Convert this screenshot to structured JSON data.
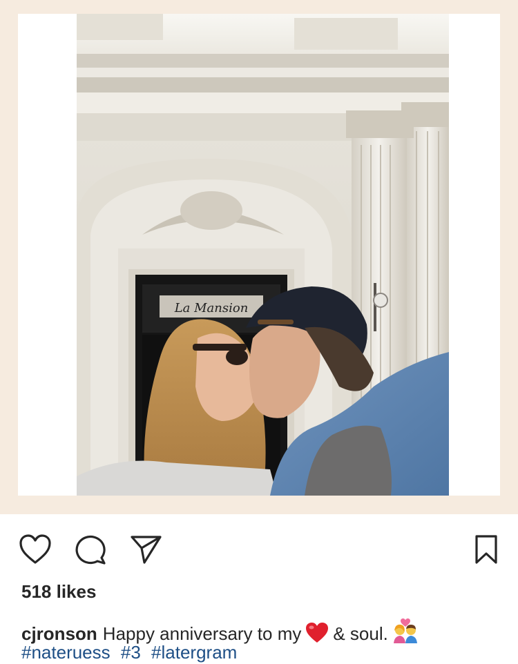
{
  "post": {
    "likes_text": "518 likes",
    "username": "cjronson",
    "caption_text_1": "Happy anniversary to my",
    "caption_emoji_1": "red-heart",
    "caption_text_2": "& soul.",
    "caption_emoji_2": "couple-with-heart",
    "hashtags": [
      "#nateruess",
      "#3",
      "#latergram"
    ],
    "sign_text": "La Mansion"
  },
  "actions": {
    "like_icon": "heart-icon",
    "comment_icon": "comment-icon",
    "share_icon": "send-icon",
    "save_icon": "bookmark-icon"
  },
  "colors": {
    "frame_background": "#f6ebdf",
    "text": "#262626",
    "hashtag": "#1e4f86",
    "heart": "#e0202d"
  }
}
